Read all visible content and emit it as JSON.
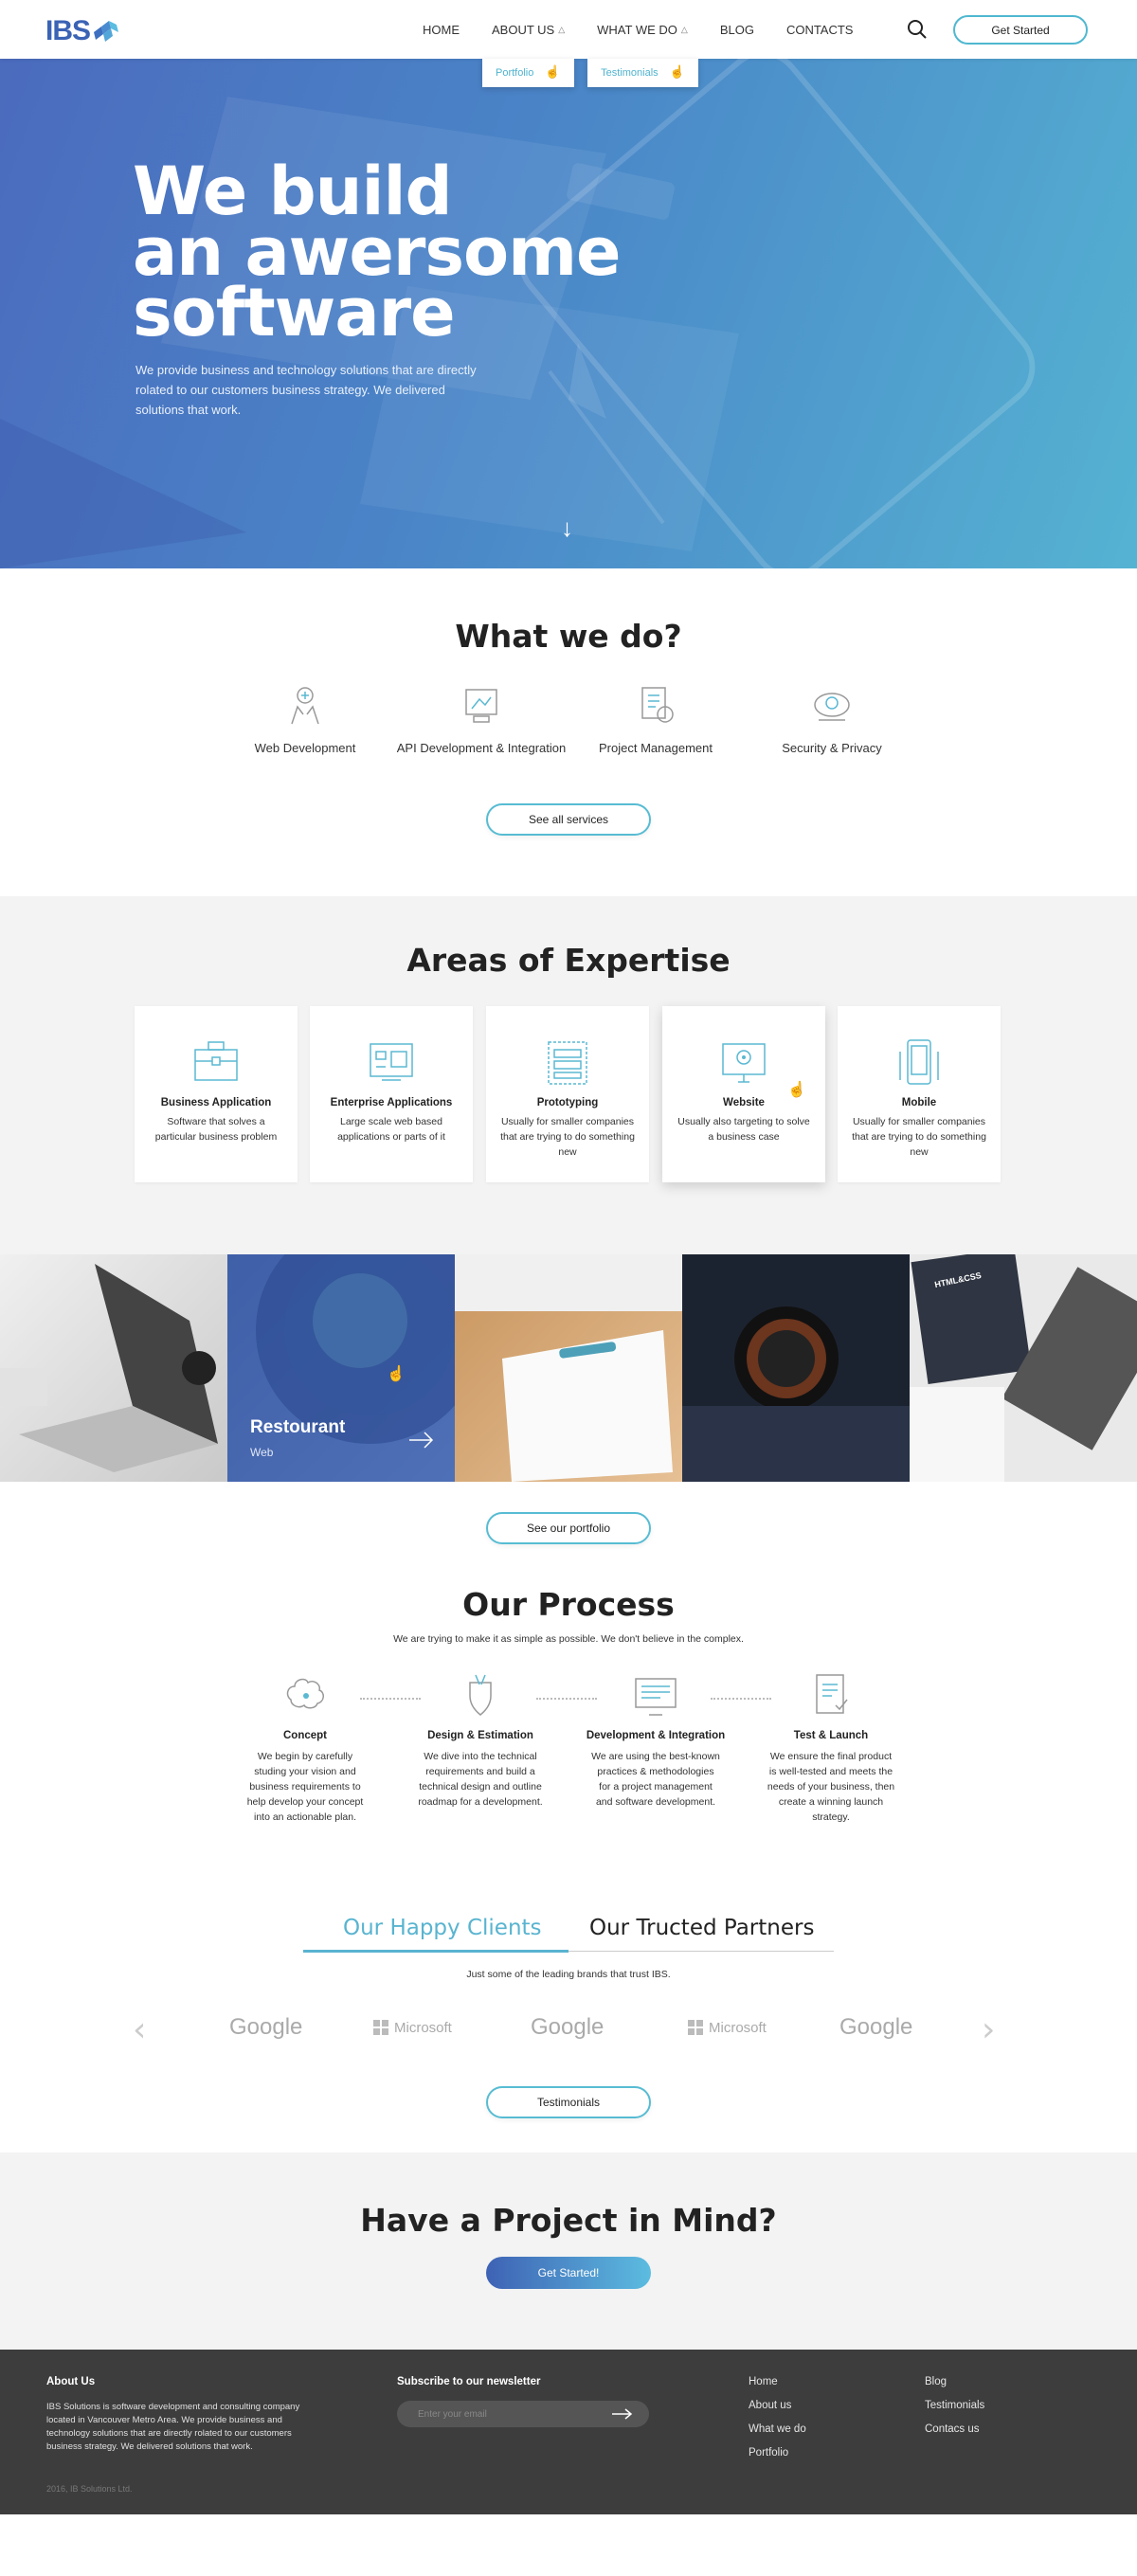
{
  "header": {
    "logo": "IBS",
    "nav": [
      {
        "label": "HOME"
      },
      {
        "label": "ABOUT US",
        "dropdown": "Portfolio"
      },
      {
        "label": "WHAT WE DO",
        "dropdown": "Testimonials"
      },
      {
        "label": "BLOG"
      },
      {
        "label": "CONTACTS"
      }
    ],
    "get_started": "Get Started",
    "icons": {
      "search": "search-icon",
      "caret": "chevron-up-icon",
      "cursor": "hand-pointer-icon"
    }
  },
  "hero": {
    "title_lines": [
      "We build",
      "an awersome",
      "software"
    ],
    "subtitle": "We provide business and technology solutions that are directly rolated to our customers business strategy. We delivered solutions that work.",
    "scroll_icon": "arrow-down-icon"
  },
  "what_we_do": {
    "title": "What we do?",
    "services": [
      {
        "label": "Web Development",
        "icon": "web-development-icon"
      },
      {
        "label": "API Development & Integration",
        "icon": "api-icon"
      },
      {
        "label": "Project Management",
        "icon": "project-management-icon"
      },
      {
        "label": "Security & Privacy",
        "icon": "security-icon"
      }
    ],
    "button": "See all services"
  },
  "expertise": {
    "title": "Areas of Expertise",
    "cards": [
      {
        "title": "Business Application",
        "desc": "Software that solves a particular business problem",
        "icon": "briefcase-icon"
      },
      {
        "title": "Enterprise Applications",
        "desc": "Large scale web based applications or parts of it",
        "icon": "enterprise-icon"
      },
      {
        "title": "Prototyping",
        "desc": "Usually for smaller companies that are trying to do something new",
        "icon": "wireframe-icon"
      },
      {
        "title": "Website",
        "desc": "Usually also targeting to solve a business case",
        "icon": "monitor-icon"
      },
      {
        "title": "Mobile",
        "desc": "Usually for smaller companies that are trying to do something new",
        "icon": "mobile-icon"
      }
    ]
  },
  "portfolio": {
    "featured_title": "Restourant",
    "featured_sub": "Web",
    "badge": "HTML&CSS",
    "button": "See our portfolio",
    "tiles": [
      "laptop-photo",
      "restaurant-food-photo",
      "wireframe-sketch-photo",
      "watch-photo",
      "desk-laptop-photo"
    ]
  },
  "process": {
    "title": "Our Process",
    "subtitle": "We are trying to make it as simple as possible. We don't believe in the complex.",
    "steps": [
      {
        "title": "Concept",
        "desc": "We begin by carefully studing your vision and business requirements to help develop your concept into an actionable plan.",
        "icon": "brain-icon"
      },
      {
        "title": "Design & Estimation",
        "desc": "We dive into the technical requirements and build a technical design and outline roadmap for a development.",
        "icon": "design-icon"
      },
      {
        "title": "Development & Integration",
        "desc": "We are using the best-known practices & methodologies for a project management and software development.",
        "icon": "development-icon"
      },
      {
        "title": "Test & Launch",
        "desc": "We ensure the final product is well-tested and meets the needs of your business, then create a winning launch strategy.",
        "icon": "test-launch-icon"
      }
    ]
  },
  "clients": {
    "tabs": [
      "Our Happy Clients",
      "Our Tructed Partners"
    ],
    "subtitle": "Just some of the leading brands that trust IBS.",
    "brands": [
      "Google",
      "Microsoft",
      "Google",
      "Microsoft",
      "Google"
    ],
    "button": "Testimonials"
  },
  "project": {
    "title": "Have a Project in Mind?",
    "button": "Get Started!"
  },
  "footer": {
    "about_title": "About Us",
    "about_text": "IBS Solutions is software development and consulting company located in Vancouver Metro Area. We provide business and technology solutions that are directly rolated to our customers business strategy. We delivered solutions that work.",
    "copyright": "2016, IB Solutions Ltd.",
    "newsletter_title": "Subscribe to our newsletter",
    "email_placeholder": "Enter your email",
    "links_col1": [
      "Home",
      "About us",
      "What we do",
      "Portfolio"
    ],
    "links_col2": [
      "Blog",
      "Testimonials",
      "Contacs us"
    ]
  }
}
